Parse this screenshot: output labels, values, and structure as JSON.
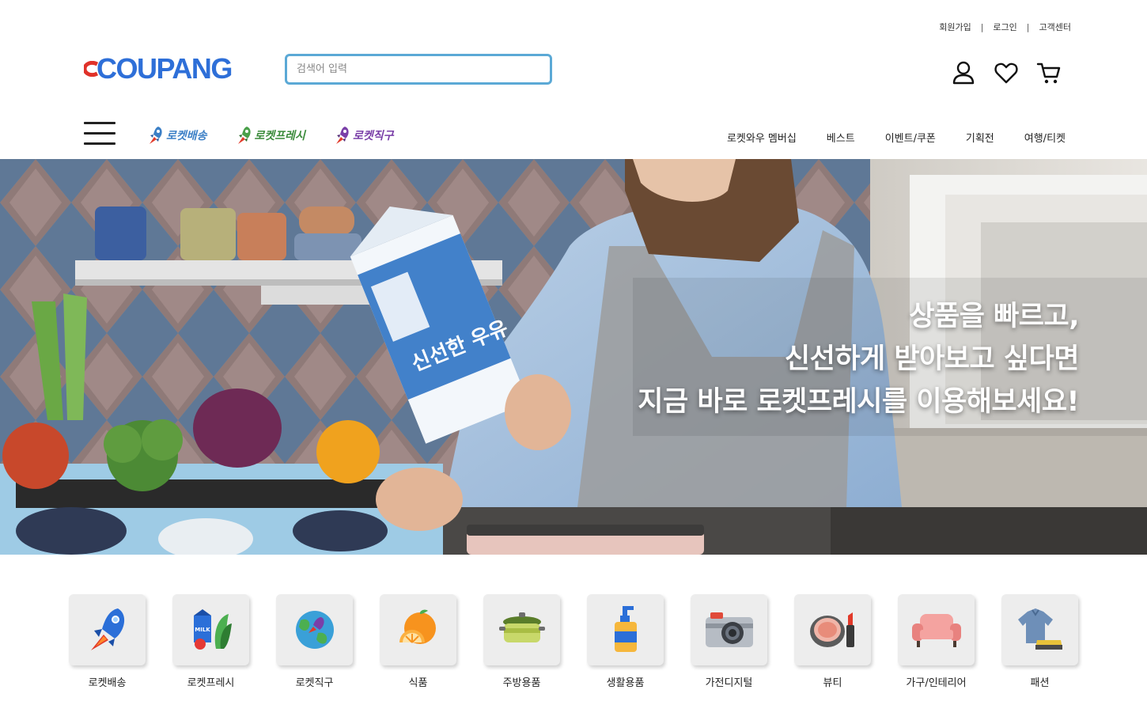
{
  "util_links": [
    "회원가입",
    "로그인",
    "고객센터"
  ],
  "util_sep": "|",
  "logo": {
    "text": "COUPANG",
    "colors": [
      "#e0322a",
      "#f3a41b",
      "#2e6fd8",
      "#59b33f",
      "#2aa7e0"
    ]
  },
  "search": {
    "placeholder": "검색어 입력",
    "border_color": "#5ba9d6"
  },
  "header_icons": [
    "user-icon",
    "heart-icon",
    "cart-icon"
  ],
  "rocket_links": [
    {
      "label": "로켓배송",
      "color": "#3b7fc6",
      "icon": "rocket-blue-icon"
    },
    {
      "label": "로켓프레시",
      "color": "#3a8a3a",
      "icon": "rocket-green-icon"
    },
    {
      "label": "로켓직구",
      "color": "#7a3fa8",
      "icon": "rocket-purple-icon"
    }
  ],
  "nav_right": [
    "로켓와우 멤버십",
    "베스트",
    "이벤트/쿠폰",
    "기획전",
    "여행/티켓"
  ],
  "hero": {
    "lines": [
      "상품을 빠르고,",
      "신선하게 받아보고 싶다면",
      "지금 바로 로켓프레시를 이용해보세요!"
    ],
    "milk_label": "신선한 우유"
  },
  "categories": [
    {
      "label": "로켓배송",
      "icon": "rocket-icon"
    },
    {
      "label": "로켓프레시",
      "icon": "milk-vegetable-icon"
    },
    {
      "label": "로켓직구",
      "icon": "globe-rocket-icon"
    },
    {
      "label": "식품",
      "icon": "orange-icon"
    },
    {
      "label": "주방용품",
      "icon": "pot-icon"
    },
    {
      "label": "생활용품",
      "icon": "pump-bottle-icon"
    },
    {
      "label": "가전디지털",
      "icon": "camera-icon"
    },
    {
      "label": "뷰티",
      "icon": "cosmetics-icon"
    },
    {
      "label": "가구/인테리어",
      "icon": "sofa-icon"
    },
    {
      "label": "패션",
      "icon": "clothes-icon"
    }
  ]
}
